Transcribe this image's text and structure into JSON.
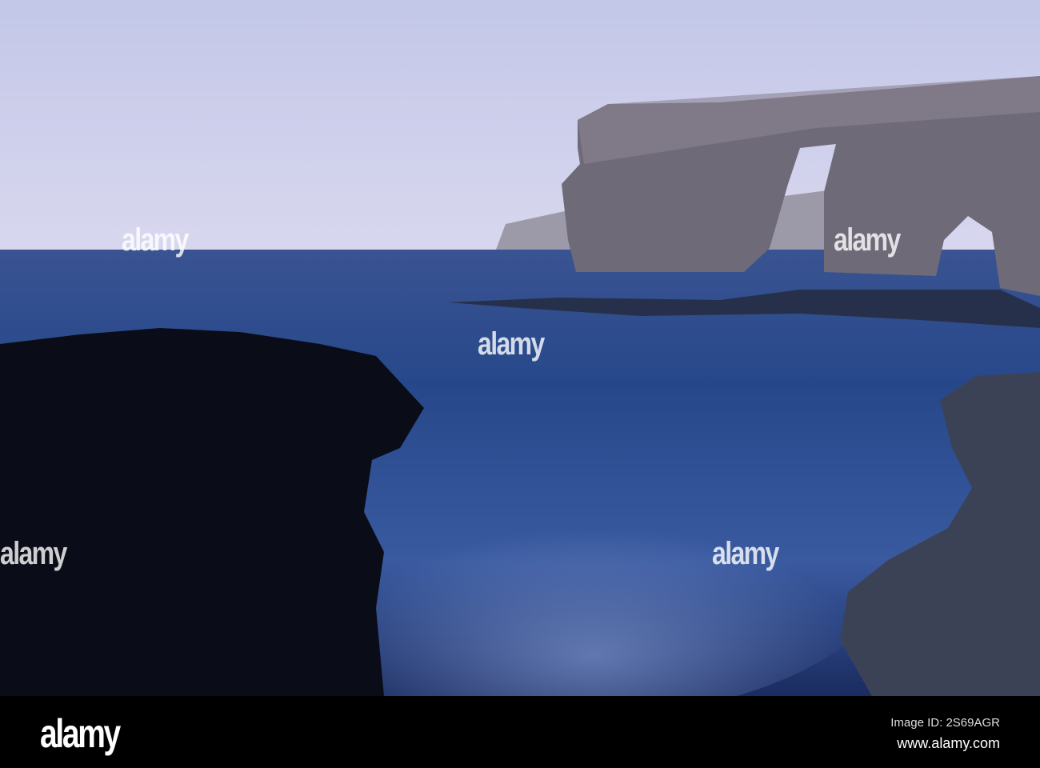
{
  "watermark": {
    "text": "alamy"
  },
  "footer": {
    "logo": "alamy",
    "image_id": "Image ID: 2S69AGR",
    "url": "www.alamy.com"
  },
  "colors": {
    "sky_top": "#c5c9e8",
    "sky_horizon": "#d5d5ee",
    "sea": "#2a4a8a",
    "rock_dark": "#0a0d18",
    "arch": "#6e6a78"
  }
}
